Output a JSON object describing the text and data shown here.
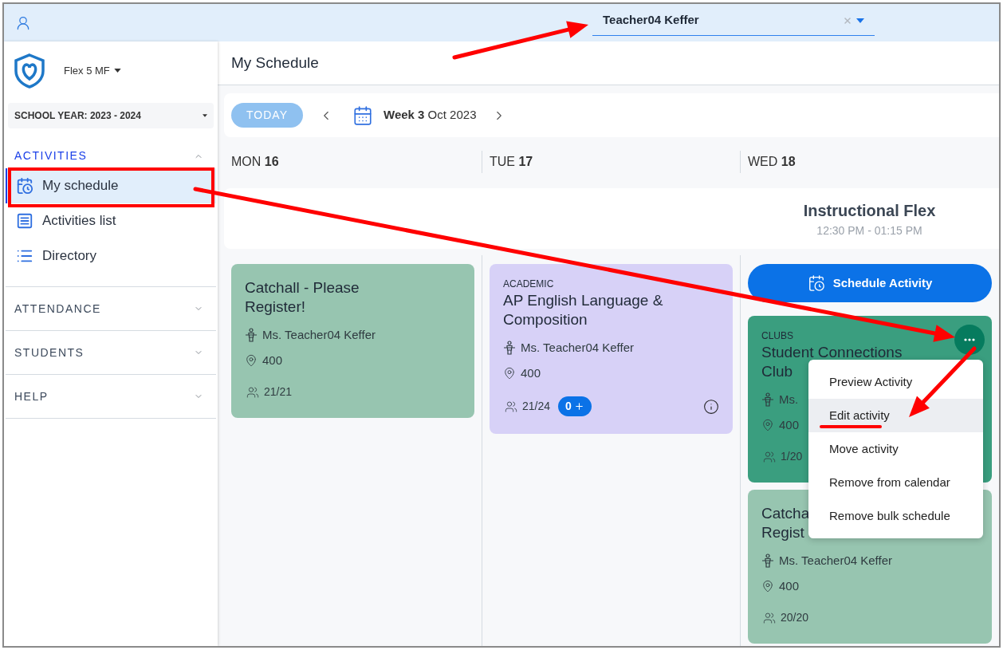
{
  "top_bar": {
    "user_select": {
      "value": "Teacher04 Keffer"
    }
  },
  "sidebar": {
    "school_name": "Flex 5 MF",
    "school_year": "SCHOOL YEAR: 2023 - 2024",
    "sections": [
      {
        "label": "ACTIVITIES",
        "expanded": true,
        "items": [
          {
            "label": "My schedule",
            "kind": "calendar",
            "selected": true
          },
          {
            "label": "Activities list",
            "kind": "list",
            "selected": false
          },
          {
            "label": "Directory",
            "kind": "directory",
            "selected": false
          }
        ]
      },
      {
        "label": "ATTENDANCE",
        "expanded": false
      },
      {
        "label": "STUDENTS",
        "expanded": false
      },
      {
        "label": "HELP",
        "expanded": false
      }
    ]
  },
  "page_title": "My Schedule",
  "toolbar": {
    "today_button": "TODAY",
    "week": "**Week 3** Oct 2023"
  },
  "days": [
    {
      "name": "MON",
      "date": "16"
    },
    {
      "name": "TUE",
      "date": "17"
    },
    {
      "name": "WED",
      "date": "18",
      "period": {
        "title": "Instructional Flex",
        "time": "12:30 PM - 01:15 PM"
      }
    }
  ],
  "columns": [
    {
      "cards": [
        {
          "title": "Catchall - Please Register!",
          "color": "#97c5b0",
          "teacher": "Ms. Teacher04 Keffer",
          "room": "400",
          "count": "21/21"
        }
      ]
    },
    {
      "cards": [
        {
          "category": "ACADEMIC",
          "title": "AP English Language & Composition",
          "color": "#d7d1f7",
          "teacher": "Ms. Teacher04 Keffer",
          "room": "400",
          "count": "21/24",
          "badge": "0",
          "info": true
        }
      ]
    },
    {
      "action_button": "Schedule Activity",
      "cards": [
        {
          "category": "CLUBS",
          "title": "Student Connections Club",
          "color": "#3a9e7f",
          "teacher": "Ms.",
          "room": "400",
          "count": "1/20",
          "menu": {
            "items": [
              {
                "label": "Preview Activity",
                "selected": false
              },
              {
                "label": "Edit activity",
                "selected": true
              },
              {
                "label": "Move activity",
                "selected": false
              },
              {
                "label": "Remove from calendar",
                "selected": false
              },
              {
                "label": "Remove bulk schedule",
                "selected": false
              }
            ]
          }
        },
        {
          "title": "Catcha\nRegist",
          "color": "#97c5b0",
          "teacher": "Ms. Teacher04 Keffer",
          "room": "400",
          "count": "20/20"
        }
      ]
    }
  ]
}
